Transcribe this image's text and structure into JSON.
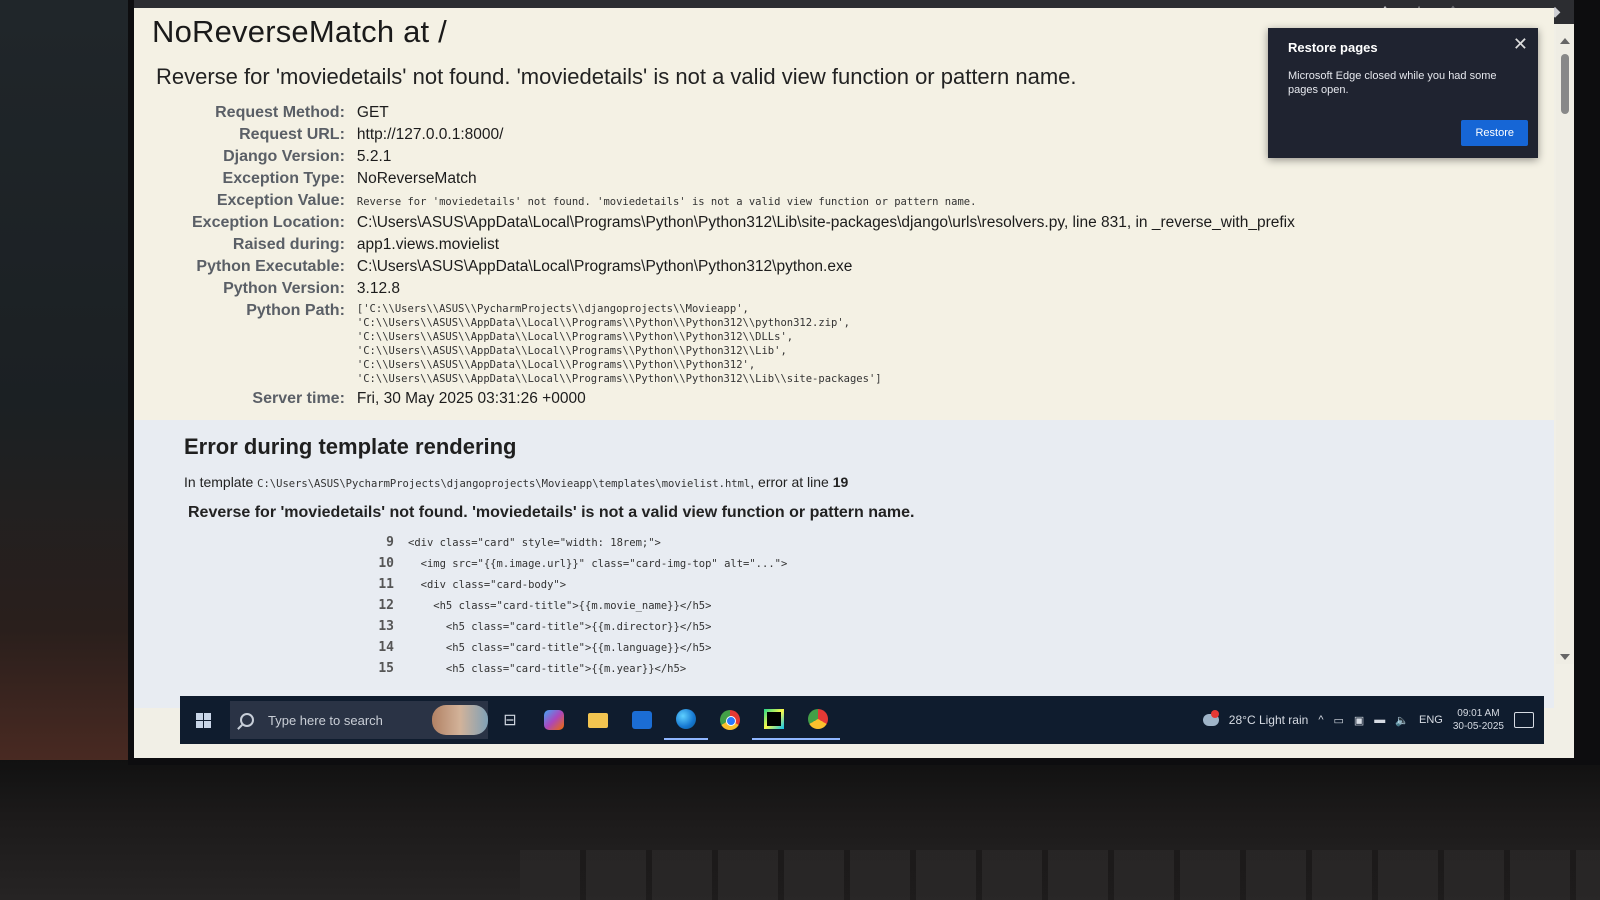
{
  "browser": {
    "toolbar_icons": [
      "read-aloud-icon",
      "favorite-star-icon",
      "favorites-icon",
      "profile-icon",
      "more-icon",
      "copilot-icon"
    ],
    "more_glyph": "···"
  },
  "error": {
    "title": "NoReverseMatch at /",
    "message": "Reverse for 'moviedetails' not found. 'moviedetails' is not a valid view function or pattern name.",
    "meta": {
      "request_method": {
        "label": "Request Method:",
        "value": "GET"
      },
      "request_url": {
        "label": "Request URL:",
        "value": "http://127.0.0.1:8000/"
      },
      "django_version": {
        "label": "Django Version:",
        "value": "5.2.1"
      },
      "exception_type": {
        "label": "Exception Type:",
        "value": "NoReverseMatch"
      },
      "exception_value": {
        "label": "Exception Value:",
        "value": "Reverse for 'moviedetails' not found. 'moviedetails' is not a valid view function or pattern name."
      },
      "exception_location": {
        "label": "Exception Location:",
        "value": "C:\\Users\\ASUS\\AppData\\Local\\Programs\\Python\\Python312\\Lib\\site-packages\\django\\urls\\resolvers.py, line 831, in _reverse_with_prefix"
      },
      "raised_during": {
        "label": "Raised during:",
        "value": "app1.views.movielist"
      },
      "python_executable": {
        "label": "Python Executable:",
        "value": "C:\\Users\\ASUS\\AppData\\Local\\Programs\\Python\\Python312\\python.exe"
      },
      "python_version": {
        "label": "Python Version:",
        "value": "3.12.8"
      },
      "python_path": {
        "label": "Python Path:",
        "lines": [
          "['C:\\\\Users\\\\ASUS\\\\PycharmProjects\\\\djangoprojects\\\\Movieapp',",
          " 'C:\\\\Users\\\\ASUS\\\\AppData\\\\Local\\\\Programs\\\\Python\\\\Python312\\\\python312.zip',",
          " 'C:\\\\Users\\\\ASUS\\\\AppData\\\\Local\\\\Programs\\\\Python\\\\Python312\\\\DLLs',",
          " 'C:\\\\Users\\\\ASUS\\\\AppData\\\\Local\\\\Programs\\\\Python\\\\Python312\\\\Lib',",
          " 'C:\\\\Users\\\\ASUS\\\\AppData\\\\Local\\\\Programs\\\\Python\\\\Python312',",
          " 'C:\\\\Users\\\\ASUS\\\\AppData\\\\Local\\\\Programs\\\\Python\\\\Python312\\\\Lib\\\\site-packages']"
        ]
      },
      "server_time": {
        "label": "Server time:",
        "value": "Fri, 30 May 2025 03:31:26 +0000"
      }
    }
  },
  "template_error": {
    "heading": "Error during template rendering",
    "in_template_prefix": "In template",
    "template_path": "C:\\Users\\ASUS\\PycharmProjects\\djangoprojects\\Movieapp\\templates\\movielist.html",
    "error_at_line_text": ", error at line",
    "error_line": "19",
    "message": "Reverse for 'moviedetails' not found. 'moviedetails' is not a valid view function or pattern name.",
    "code_lines": [
      {
        "num": "9",
        "text": "<div class=\"card\" style=\"width: 18rem;\">"
      },
      {
        "num": "10",
        "text": "  <img src=\"{{m.image.url}}\" class=\"card-img-top\" alt=\"...\">"
      },
      {
        "num": "11",
        "text": "  <div class=\"card-body\">"
      },
      {
        "num": "12",
        "text": "    <h5 class=\"card-title\">{{m.movie_name}}</h5>"
      },
      {
        "num": "13",
        "text": "      <h5 class=\"card-title\">{{m.director}}</h5>"
      },
      {
        "num": "14",
        "text": "      <h5 class=\"card-title\">{{m.language}}</h5>"
      },
      {
        "num": "15",
        "text": "      <h5 class=\"card-title\">{{m.year}}</h5>"
      }
    ]
  },
  "restore_popup": {
    "title": "Restore pages",
    "body": "Microsoft Edge closed while you had some pages open.",
    "button": "Restore",
    "close_glyph": "✕"
  },
  "taskbar": {
    "search_placeholder": "Type here to search",
    "apps": [
      "task-view-icon",
      "copilot-icon",
      "file-explorer-icon",
      "outlook-icon",
      "edge-icon",
      "chrome-icon",
      "pycharm-icon",
      "chrome-profile-icon"
    ],
    "task_view_glyph": "⊟",
    "weather": "28°C  Light rain",
    "tray_chevron": "^",
    "tray_glyphs": [
      "▭",
      "▣",
      "▬",
      "🔈"
    ],
    "language": "ENG",
    "time": "09:01 AM",
    "date": "30-05-2025"
  }
}
